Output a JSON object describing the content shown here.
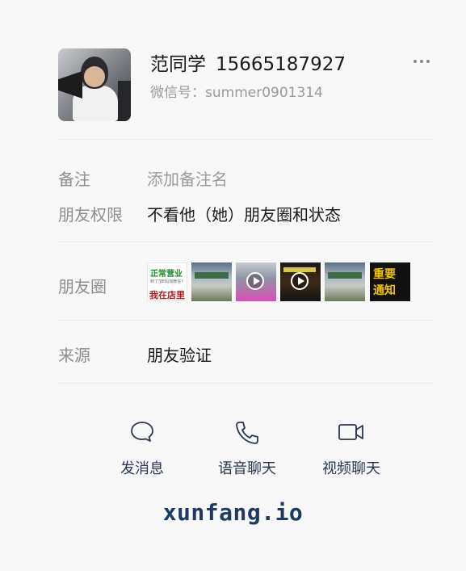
{
  "profile": {
    "name": "范同学",
    "phone": "15665187927",
    "wechat_id_label": "微信号：",
    "wechat_id": "summer0901314"
  },
  "fields": {
    "remark_label": "备注",
    "remark_placeholder": "添加备注名",
    "permission_label": "朋友权限",
    "permission_value": "不看他（她）朋友圈和状态",
    "moments_label": "朋友圈",
    "source_label": "来源",
    "source_value": "朋友验证"
  },
  "moments_thumbs": [
    {
      "lines": [
        "正常营业",
        "到了加E码加微信?",
        "我在店里"
      ]
    },
    {
      "lines": []
    },
    {
      "lines": []
    },
    {
      "lines": []
    },
    {
      "lines": []
    },
    {
      "lines": [
        "重要",
        "通知"
      ]
    }
  ],
  "actions": {
    "message": "发消息",
    "voice": "语音聊天",
    "video": "视频聊天"
  },
  "watermark": "xunfang.io",
  "icons": [
    "more-icon",
    "chat-icon",
    "phone-icon",
    "video-icon",
    "play-icon"
  ],
  "colors": {
    "action_text": "#2a3650",
    "label_gray": "#8e8e8e",
    "brand": "#1e3a64"
  }
}
